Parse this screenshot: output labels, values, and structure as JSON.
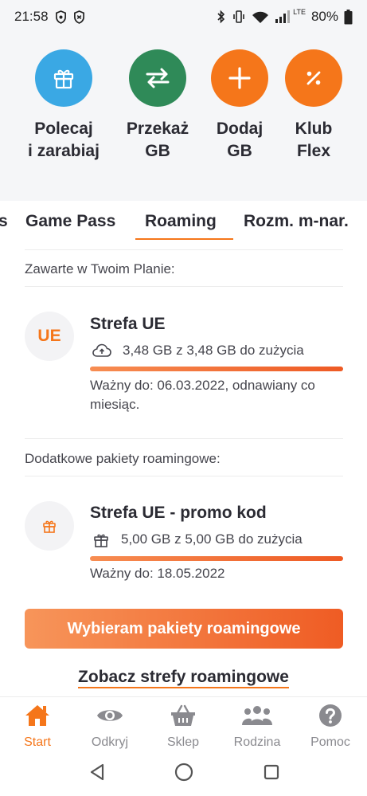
{
  "status_bar": {
    "time": "21:58",
    "lte": "LTE",
    "battery": "80%"
  },
  "quick_actions": [
    {
      "label": "Polecaj\ni zarabiaj",
      "icon": "gift-icon",
      "color": "#3aa8e4"
    },
    {
      "label": "Przekaż\nGB",
      "icon": "transfer-arrows-icon",
      "color": "#2f8a58"
    },
    {
      "label": "Dodaj\nGB",
      "icon": "plus-icon",
      "color": "#f5761a"
    },
    {
      "label": "Klub\nFlex",
      "icon": "percent-icon",
      "color": "#f5761a"
    }
  ],
  "tabs": [
    {
      "label": "s"
    },
    {
      "label": "Game Pass"
    },
    {
      "label": "Roaming",
      "active": true
    },
    {
      "label": "Rozm. m-nar."
    }
  ],
  "included": {
    "header": "Zawarte w Twoim Planie:",
    "badge": "UE",
    "title": "Strefa UE",
    "usage": "3,48 GB z 3,48 GB do zużycia",
    "usage_icon": "cloud-upload-icon",
    "remaining_fraction": 1.0,
    "valid": "Ważny do: 06.03.2022, odnawiany co miesiąc."
  },
  "additional": {
    "header": "Dodatkowe pakiety roamingowe:",
    "badge_icon": "gift-icon",
    "title": "Strefa UE - promo kod",
    "usage": "5,00 GB z 5,00 GB do zużycia",
    "usage_icon": "gift-icon",
    "remaining_fraction": 1.0,
    "valid": "Ważny do: 18.05.2022"
  },
  "cta_label": "Wybieram pakiety roamingowe",
  "zones_link": "Zobacz strefy roamingowe",
  "bottom_nav": [
    {
      "label": "Start",
      "icon": "home-icon",
      "active": true
    },
    {
      "label": "Odkryj",
      "icon": "eye-icon"
    },
    {
      "label": "Sklep",
      "icon": "basket-icon"
    },
    {
      "label": "Rodzina",
      "icon": "family-icon"
    },
    {
      "label": "Pomoc",
      "icon": "help-icon"
    }
  ],
  "colors": {
    "accent": "#f5761a",
    "blue": "#3aa8e4",
    "green": "#2f8a58",
    "text": "#2b2b33",
    "muted": "#8a8a8f"
  }
}
